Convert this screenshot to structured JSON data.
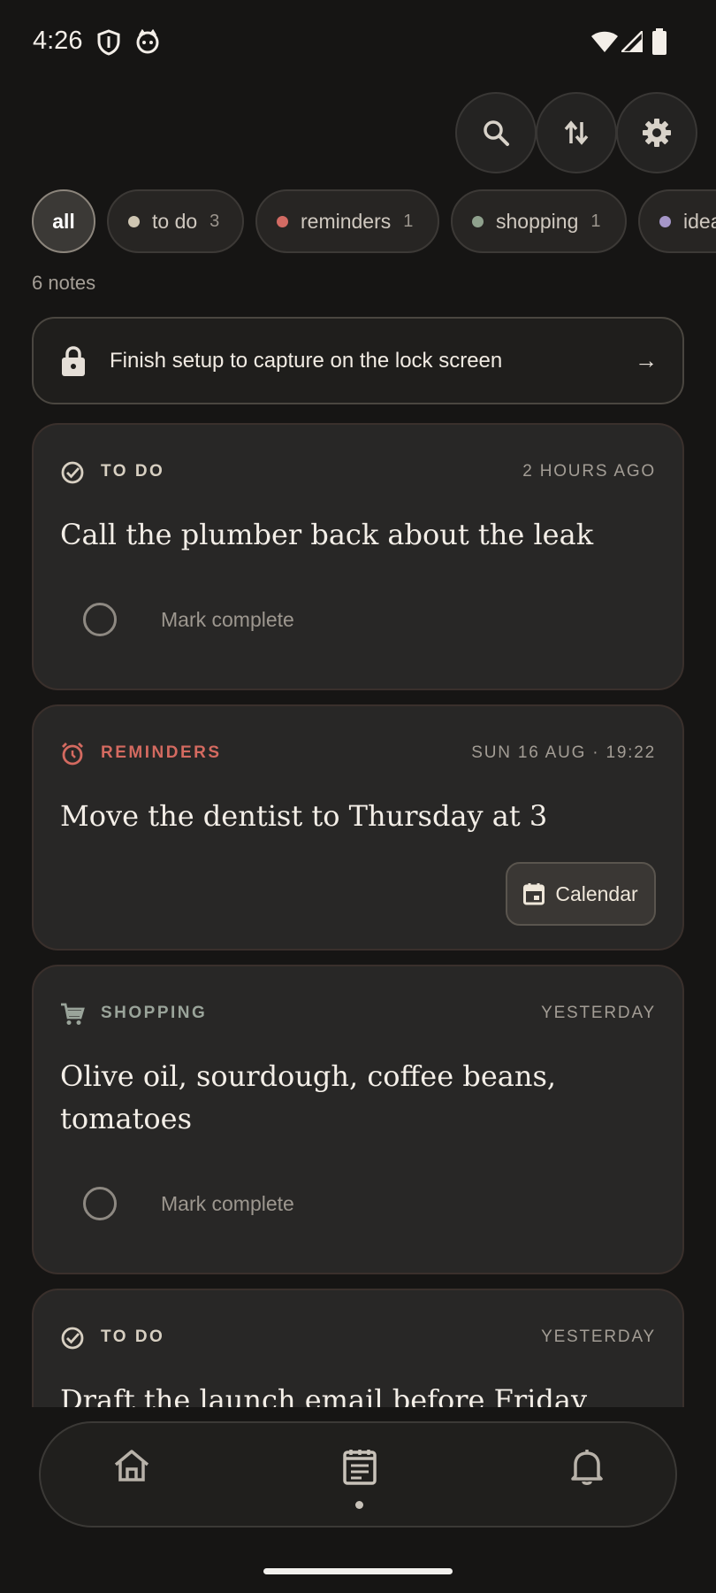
{
  "status_bar": {
    "time": "4:26",
    "icons": [
      "shield-icon",
      "cat-face-icon",
      "wifi-icon",
      "signal-icon",
      "battery-icon"
    ]
  },
  "actions": {
    "icons": [
      "search-icon",
      "sort-icon",
      "gear-icon"
    ]
  },
  "filters": {
    "chips": [
      {
        "label": "all",
        "count": "",
        "color": ""
      },
      {
        "label": "to do",
        "count": "3",
        "color": "#cfc6b2"
      },
      {
        "label": "reminders",
        "count": "1",
        "color": "#d26b63"
      },
      {
        "label": "shopping",
        "count": "1",
        "color": "#8fa18d"
      },
      {
        "label": "ideas",
        "count": "",
        "color": "#a596c8"
      }
    ],
    "selected": "all"
  },
  "notes_count": "6 notes",
  "setup_banner": {
    "text": "Finish setup to capture on the lock screen",
    "arrow": "→"
  },
  "notes": [
    {
      "category": "TO DO",
      "category_color": "#d8d0c2",
      "time": "2 HOURS AGO",
      "title": "Call the plumber back about the leak",
      "action": "Mark complete"
    },
    {
      "category": "REMINDERS",
      "category_color": "#d46a60",
      "time": "SUN 16 AUG · 19:22",
      "title": "Move the dentist to Thursday at 3",
      "action": "Calendar"
    },
    {
      "category": "SHOPPING",
      "category_color": "#9aa49a",
      "time": "YESTERDAY",
      "title": "Olive oil, sourdough, coffee beans, tomatoes",
      "action": "Mark complete"
    },
    {
      "category": "TO DO",
      "category_color": "#d8d0c2",
      "time": "YESTERDAY",
      "title": "Draft the launch email before Friday",
      "action": ""
    }
  ],
  "bottom_nav": {
    "items": [
      "home-icon",
      "notes-icon",
      "bell-icon"
    ],
    "active": "notes-icon"
  }
}
